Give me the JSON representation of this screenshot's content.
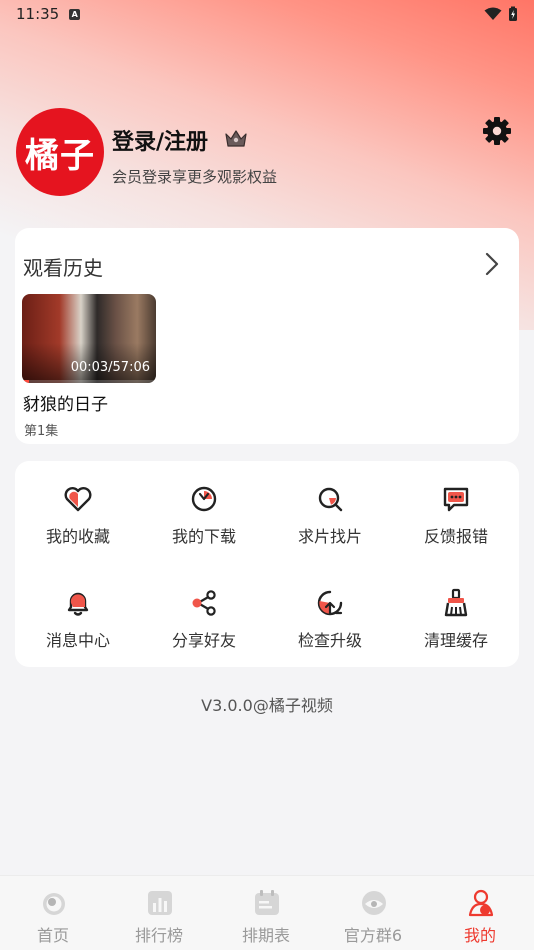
{
  "status_bar": {
    "time": "11:35",
    "notif_letter": "A"
  },
  "profile": {
    "avatar_text": "橘子",
    "login_title": "登录/注册",
    "subtitle": "会员登录享更多观影权益"
  },
  "history": {
    "title": "观看历史",
    "items": [
      {
        "title": "豺狼的日子",
        "episode": "第1集",
        "time": "00:03/57:06",
        "progress": 0.05
      }
    ]
  },
  "menu": {
    "items": [
      {
        "label": "我的收藏",
        "icon": "heart-icon"
      },
      {
        "label": "我的下载",
        "icon": "download-icon"
      },
      {
        "label": "求片找片",
        "icon": "search-film-icon"
      },
      {
        "label": "反馈报错",
        "icon": "feedback-icon"
      },
      {
        "label": "消息中心",
        "icon": "bell-icon"
      },
      {
        "label": "分享好友",
        "icon": "share-icon"
      },
      {
        "label": "检查升级",
        "icon": "upgrade-icon"
      },
      {
        "label": "清理缓存",
        "icon": "broom-icon"
      }
    ]
  },
  "version": "V3.0.0@橘子视频",
  "nav": {
    "items": [
      {
        "label": "首页",
        "icon": "home-icon"
      },
      {
        "label": "排行榜",
        "icon": "ranking-icon"
      },
      {
        "label": "排期表",
        "icon": "schedule-icon"
      },
      {
        "label": "官方群6",
        "icon": "group-icon"
      },
      {
        "label": "我的",
        "icon": "profile-icon",
        "active": true
      }
    ]
  },
  "colors": {
    "accent": "#ee3a2f",
    "avatar": "#e5141f",
    "icon_red": "#f0564a"
  }
}
